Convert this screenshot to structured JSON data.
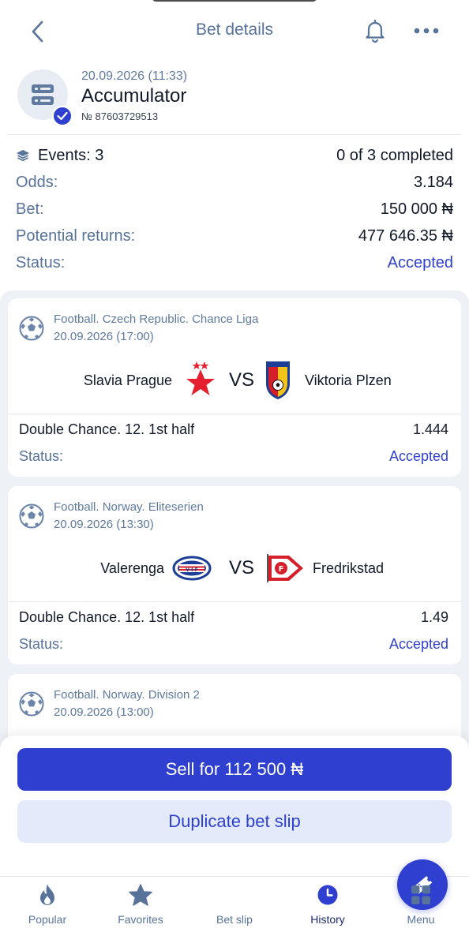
{
  "header": {
    "title": "Bet details",
    "back_icon": "chevron-left-icon",
    "bell_icon": "bell-icon",
    "more_icon": "more-horizontal-icon"
  },
  "bet": {
    "date": "20.09.2026 (11:33)",
    "type": "Accumulator",
    "number": "№ 87603729513"
  },
  "summary": {
    "events_label": "Events: 3",
    "events_completed": "0 of 3 completed",
    "odds_label": "Odds:",
    "odds_value": "3.184",
    "bet_label": "Bet:",
    "bet_value": "150 000 ₦",
    "returns_label": "Potential returns:",
    "returns_value": "477 646.35 ₦",
    "status_label": "Status:",
    "status_value": "Accepted"
  },
  "events": [
    {
      "league": "Football. Czech Republic. Chance Liga",
      "kickoff": "20.09.2026 (17:00)",
      "home": "Slavia Prague",
      "vs": "VS",
      "away": "Viktoria Plzen",
      "market": "Double Chance. 12. 1st half",
      "odd": "1.444",
      "status_label": "Status:",
      "status_value": "Accepted"
    },
    {
      "league": "Football. Norway. Eliteserien",
      "kickoff": "20.09.2026 (13:30)",
      "home": "Valerenga",
      "vs": "VS",
      "away": "Fredrikstad",
      "market": "Double Chance. 12. 1st half",
      "odd": "1.49",
      "status_label": "Status:",
      "status_value": "Accepted"
    },
    {
      "league": "Football. Norway. Division 2",
      "kickoff": "20.09.2026 (13:00)"
    }
  ],
  "actions": {
    "sell_label": "Sell for 112 500 ₦",
    "duplicate_label": "Duplicate bet slip"
  },
  "tabbar": {
    "items": [
      {
        "label": "Popular",
        "icon": "flame-icon"
      },
      {
        "label": "Favorites",
        "icon": "star-icon"
      },
      {
        "label": "Bet slip",
        "icon": "ticket-icon"
      },
      {
        "label": "History",
        "icon": "clock-icon"
      },
      {
        "label": "Menu",
        "icon": "grid-icon"
      }
    ],
    "active": "History"
  },
  "colors": {
    "accent": "#2f3fcf",
    "label": "#58739a",
    "panel_bg": "#eef2f6",
    "duplicate_bg": "#e3ebfb",
    "slavia_red": "#e4202e",
    "fredrikstad_red": "#d51f2a"
  }
}
